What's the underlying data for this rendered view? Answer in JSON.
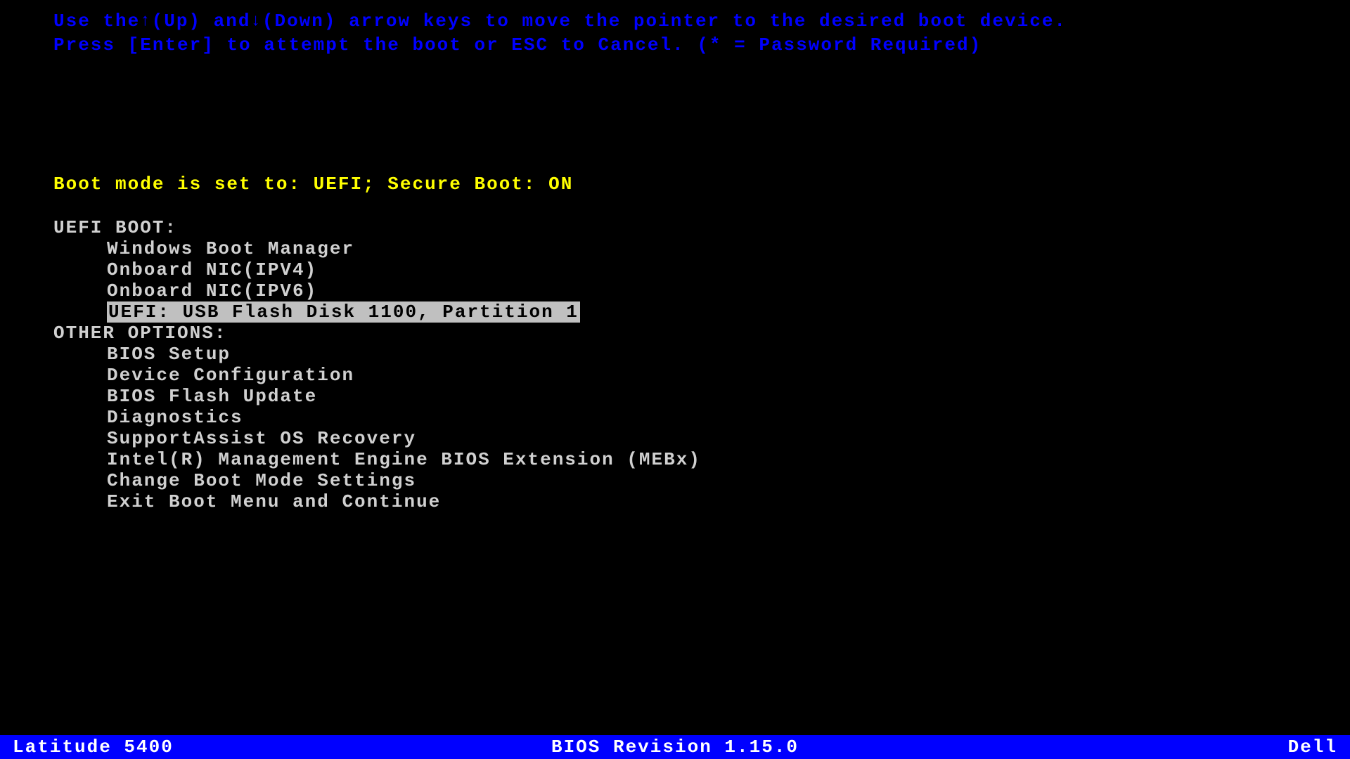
{
  "instructions": {
    "line1_part1": "Use the ",
    "line1_up": "↑",
    "line1_part2": "(Up) and ",
    "line1_down": "↓",
    "line1_part3": "(Down) arrow keys to move the pointer to the desired boot device.",
    "line2": "Press [Enter] to attempt the boot or ESC to Cancel. (* = Password Required)"
  },
  "boot_mode": "Boot mode is set to: UEFI; Secure Boot: ON",
  "sections": {
    "uefi_boot": {
      "header": "UEFI BOOT:",
      "items": [
        "Windows Boot Manager",
        "Onboard NIC(IPV4)",
        "Onboard NIC(IPV6)",
        "UEFI: USB Flash Disk 1100, Partition 1"
      ],
      "selected_index": 3
    },
    "other_options": {
      "header": "OTHER OPTIONS:",
      "items": [
        "BIOS Setup",
        "Device Configuration",
        "BIOS Flash Update",
        "Diagnostics",
        "SupportAssist OS Recovery",
        "Intel(R) Management Engine BIOS Extension (MEBx)",
        "Change Boot Mode Settings",
        "Exit Boot Menu and Continue"
      ]
    }
  },
  "status_bar": {
    "model": "Latitude 5400",
    "bios_revision": "BIOS Revision 1.15.0",
    "vendor": "Dell"
  }
}
